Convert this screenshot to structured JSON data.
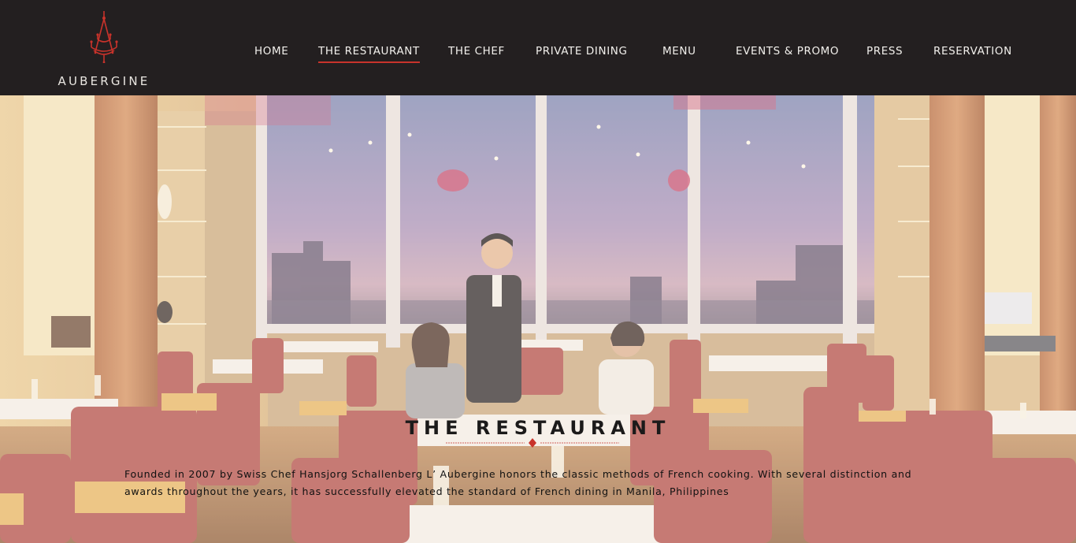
{
  "brand": {
    "name": "AUBERGINE",
    "accent_color": "#c8332b",
    "header_background": "#231f20",
    "logo_icon": "chandelier-icon"
  },
  "nav": {
    "items": [
      {
        "label": "HOME",
        "active": false
      },
      {
        "label": "THE RESTAURANT",
        "active": true
      },
      {
        "label": "THE CHEF",
        "active": false
      },
      {
        "label": "PRIVATE DINING",
        "active": false
      },
      {
        "label": "MENU",
        "active": false
      },
      {
        "label": "EVENTS & PROMO",
        "active": false
      },
      {
        "label": "PRESS",
        "active": false
      },
      {
        "label": "RESERVATION",
        "active": false
      }
    ]
  },
  "hero": {
    "title": "THE RESTAURANT",
    "description": "Founded in 2007 by Swiss Chef Hansjorg Schallenberg L’ Aubergine honors the classic methods of French cooking. With several distinction and awards throughout the years, it has successfully elevated the standard of French dining in Manila, Philippines",
    "divider_icon": "diamond-divider-icon"
  }
}
